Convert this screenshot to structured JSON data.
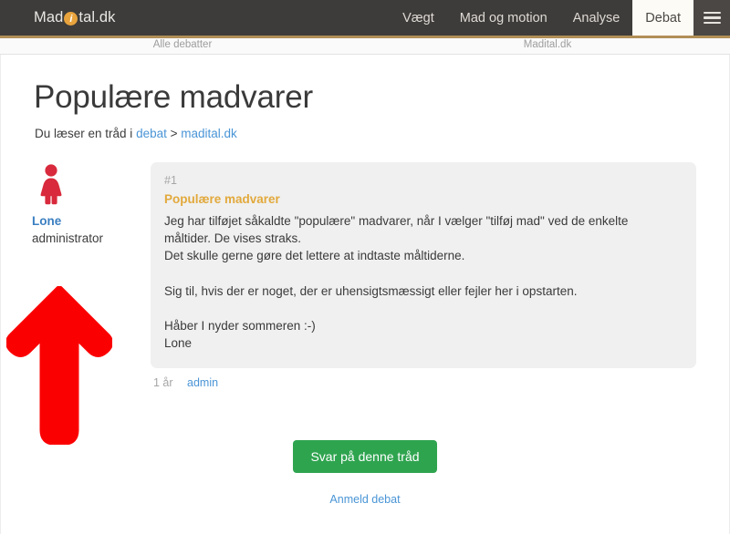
{
  "header": {
    "brand": {
      "prefix": "Mad",
      "icon_letter": "i",
      "suffix": "tal.dk",
      "icon_name": "info-dot-icon"
    },
    "nav_items": [
      {
        "label": "Vægt",
        "active": false
      },
      {
        "label": "Mad og motion",
        "active": false
      },
      {
        "label": "Analyse",
        "active": false
      },
      {
        "label": "Debat",
        "active": true
      }
    ],
    "menu_icon": "hamburger-menu-icon",
    "accent_gold": "#b18f56",
    "bar_color": "#3e3c3a"
  },
  "subnav": {
    "left_label": "Alle debatter",
    "right_label": "Madital.dk"
  },
  "main": {
    "title": "Populære madvarer",
    "breadcrumb": {
      "prefix": "Du læser en tråd i",
      "link1": "debat",
      "separator": ">",
      "link2": "madital.dk"
    }
  },
  "author": {
    "avatar_icon": "female-user-avatar-icon",
    "avatar_color": "#d82a3c",
    "name": "Lone",
    "role": "administrator"
  },
  "post": {
    "number": "#1",
    "subject": "Populære madvarer",
    "body": "Jeg har tilføjet såkaldte \"populære\" madvarer, når I vælger \"tilføj mad\" ved de enkelte måltider. De vises straks.\nDet skulle gerne gøre det lettere at indtaste måltiderne.\n\nSig til, hvis der er noget, der er uhensigtsmæssigt eller fejler her i opstarten.\n\nHåber I nyder sommeren :-)\nLone",
    "age": "1 år",
    "poster": "admin",
    "subject_color": "#e2a93c",
    "background": "#f0f0f0"
  },
  "actions": {
    "reply_label": "Svar på denne tråd",
    "reply_color": "#2fa44f",
    "report_label": "Anmeld debat",
    "link_color": "#4a95d6"
  },
  "annotation": {
    "arrow_icon": "red-up-arrow-annotation",
    "color": "#fb0000",
    "points_at": "administrator"
  }
}
